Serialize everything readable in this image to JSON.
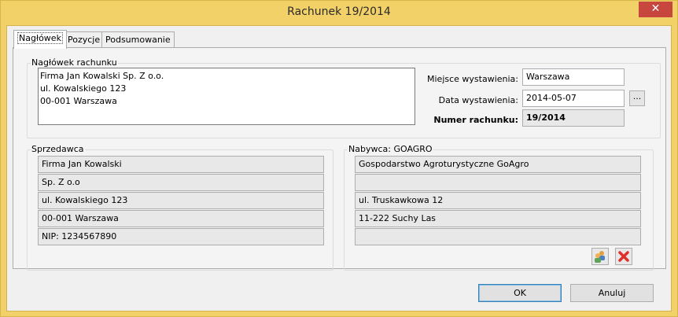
{
  "window": {
    "title": "Rachunek 19/2014",
    "close_symbol": "✕"
  },
  "tabs": [
    {
      "label": "Nagłówek"
    },
    {
      "label": "Pozycje"
    },
    {
      "label": "Podsumowanie"
    }
  ],
  "header_group": {
    "label": "Nagłówek rachunku",
    "issuer_lines": [
      "Firma Jan Kowalski Sp. Z o.o.",
      "ul. Kowalskiego 123",
      "00-001 Warszawa"
    ],
    "place_label": "Miejsce wystawienia:",
    "place_value": "Warszawa",
    "date_label": "Data wystawienia:",
    "date_value": "2014-05-07",
    "date_button": "...",
    "number_label": "Numer rachunku:",
    "number_value": "19/2014"
  },
  "seller": {
    "label": "Sprzedawca",
    "lines": [
      "Firma Jan Kowalski",
      "Sp. Z o.o",
      "ul. Kowalskiego 123",
      "00-001 Warszawa",
      "NIP: 1234567890"
    ]
  },
  "buyer": {
    "label": "Nabywca: GOAGRO",
    "lines": [
      "Gospodarstwo Agroturystyczne GoAgro",
      "",
      "ul. Truskawkowa 12",
      "11-222 Suchy Las",
      ""
    ],
    "select_icon": "users-icon",
    "delete_icon": "delete-x-icon"
  },
  "footer": {
    "ok_label": "OK",
    "cancel_label": "Anuluj"
  },
  "colors": {
    "frame": "#f1d168",
    "close": "#c7473f",
    "delete": "#e0302a"
  }
}
